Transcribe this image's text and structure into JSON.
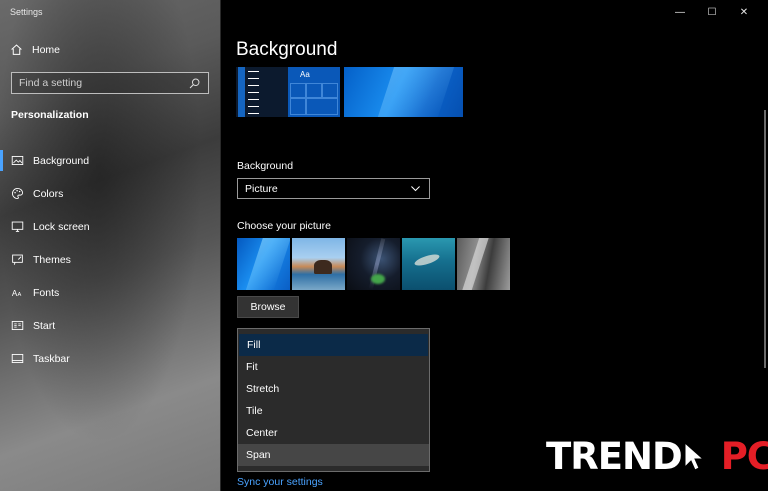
{
  "window": {
    "title": "Settings",
    "controls": {
      "minimize": "—",
      "maximize": "☐",
      "close": "✕"
    }
  },
  "sidebar": {
    "home_label": "Home",
    "search_placeholder": "Find a setting",
    "section_title": "Personalization",
    "items": [
      {
        "label": "Background",
        "icon": "image-icon",
        "active": true
      },
      {
        "label": "Colors",
        "icon": "palette-icon",
        "active": false
      },
      {
        "label": "Lock screen",
        "icon": "lock-screen-icon",
        "active": false
      },
      {
        "label": "Themes",
        "icon": "themes-icon",
        "active": false
      },
      {
        "label": "Fonts",
        "icon": "fonts-icon",
        "active": false
      },
      {
        "label": "Start",
        "icon": "start-icon",
        "active": false
      },
      {
        "label": "Taskbar",
        "icon": "taskbar-icon",
        "active": false
      }
    ]
  },
  "main": {
    "page_title": "Background",
    "preview_tile_text": "Aa",
    "background_label": "Background",
    "background_value": "Picture",
    "choose_picture_label": "Choose your picture",
    "browse_label": "Browse",
    "fit_options": [
      "Fill",
      "Fit",
      "Stretch",
      "Tile",
      "Center",
      "Span"
    ],
    "fit_selected": "Fill",
    "fit_hovered": "Span",
    "sync_link": "Sync your settings"
  },
  "watermark": {
    "part1": "TREND",
    "part2": "PC"
  },
  "colors": {
    "accent": "#4aa3ff",
    "watermark_red": "#e41e26"
  }
}
